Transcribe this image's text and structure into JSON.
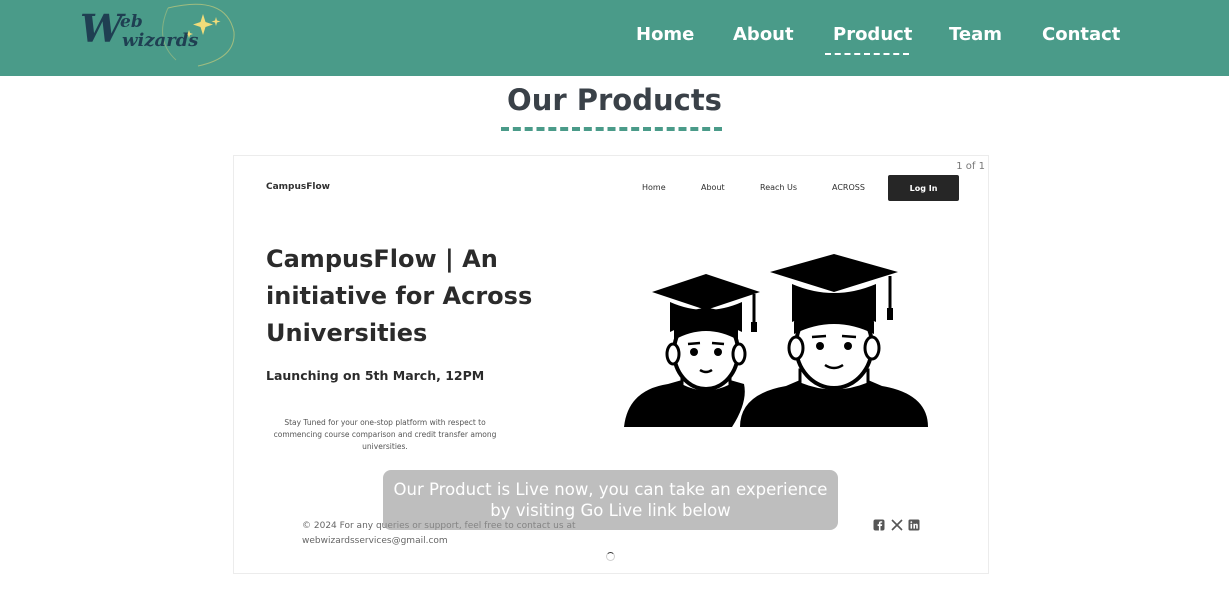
{
  "header": {
    "logo": {
      "text_main": "W",
      "text_top": "eb",
      "text_bottom": "wizards"
    },
    "nav": [
      {
        "label": "Home"
      },
      {
        "label": "About"
      },
      {
        "label": "Product"
      },
      {
        "label": "Team"
      },
      {
        "label": "Contact"
      }
    ]
  },
  "main": {
    "title": "Our Products"
  },
  "preview": {
    "page_count": "1 of 1",
    "brand": "CampusFlow",
    "nav": [
      "Home",
      "About",
      "Reach Us",
      "ACROSS"
    ],
    "login_label": "Log In",
    "heading": "CampusFlow | An initiative for Across Universities",
    "launch": "Launching on 5th March, 12PM",
    "subtext": "Stay Tuned for your one-stop platform with respect to commencing course comparison and credit transfer among universities.",
    "footer_line1": "© 2024 For any queries or support, feel free to contact us at",
    "footer_line2": "webwizardsservices@gmail.com",
    "social_icons": [
      "facebook-icon",
      "x-icon",
      "linkedin-icon"
    ]
  },
  "overlay": {
    "text": "Our Product is Live now, you can take an experience by visiting Go Live link below"
  },
  "colors": {
    "header_bg": "#4a9b89",
    "title_text": "#3a4148",
    "accent_underline": "#4a9b89",
    "login_bg": "#262626"
  }
}
